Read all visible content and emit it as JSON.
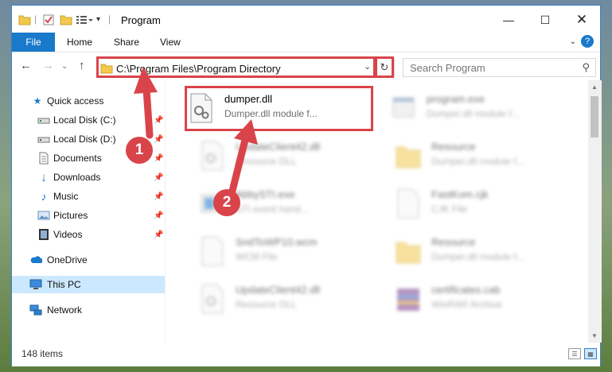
{
  "window": {
    "title": "Program",
    "controls": [
      "minimize",
      "maximize",
      "close"
    ]
  },
  "ribbon": {
    "tabs": [
      "File",
      "Home",
      "Share",
      "View"
    ]
  },
  "address": {
    "path": "C:\\Program Files\\Program Directory"
  },
  "search": {
    "placeholder": "Search Program"
  },
  "nav": {
    "items": [
      {
        "label": "Quick access",
        "icon": "star-icon",
        "pinned": false
      },
      {
        "label": "Local Disk (C:)",
        "icon": "drive-icon",
        "pinned": true
      },
      {
        "label": "Local Disk (D:)",
        "icon": "drive-icon",
        "pinned": true
      },
      {
        "label": "Documents",
        "icon": "document-icon",
        "pinned": true
      },
      {
        "label": "Downloads",
        "icon": "download-icon",
        "pinned": true
      },
      {
        "label": "Music",
        "icon": "music-icon",
        "pinned": true
      },
      {
        "label": "Pictures",
        "icon": "picture-icon",
        "pinned": true
      },
      {
        "label": "Videos",
        "icon": "video-icon",
        "pinned": true
      },
      {
        "label": "OneDrive",
        "icon": "cloud-icon",
        "pinned": false
      },
      {
        "label": "This PC",
        "icon": "computer-icon",
        "pinned": false,
        "selected": true
      },
      {
        "label": "Network",
        "icon": "network-icon",
        "pinned": false
      }
    ]
  },
  "files": [
    {
      "name": "dumper.dll",
      "desc": "Dumper.dll module f...",
      "icon": "dll-file-icon",
      "highlighted": true
    },
    {
      "name": "program.exe",
      "desc": "Dumper.dll module f...",
      "icon": "exe-file-icon"
    },
    {
      "name": "UpdateClient42.dll",
      "desc": "Resource DLL",
      "icon": "dll-file-icon"
    },
    {
      "name": "Resource",
      "desc": "Dumper.dll module f...",
      "icon": "folder-icon"
    },
    {
      "name": "AbbySTI.exe",
      "desc": "STI event hand...",
      "icon": "exe-file-icon"
    },
    {
      "name": "FastKom.cjk",
      "desc": "CJK File",
      "icon": "generic-file-icon"
    },
    {
      "name": "SndToWP10.wcm",
      "desc": "WCM File",
      "icon": "generic-file-icon"
    },
    {
      "name": "Resource",
      "desc": "Dumper.dll module f...",
      "icon": "folder-icon"
    },
    {
      "name": "UpdateClient42.dll",
      "desc": "Resource DLL",
      "icon": "dll-file-icon"
    },
    {
      "name": "certificates.cab",
      "desc": "WinRAR Archive",
      "icon": "archive-icon"
    }
  ],
  "status": {
    "item_count": "148 items"
  },
  "annotations": {
    "step1": "1",
    "step2": "2"
  },
  "colors": {
    "accent": "#1979ca",
    "highlight": "#d9444a",
    "selection": "#cce8ff"
  }
}
